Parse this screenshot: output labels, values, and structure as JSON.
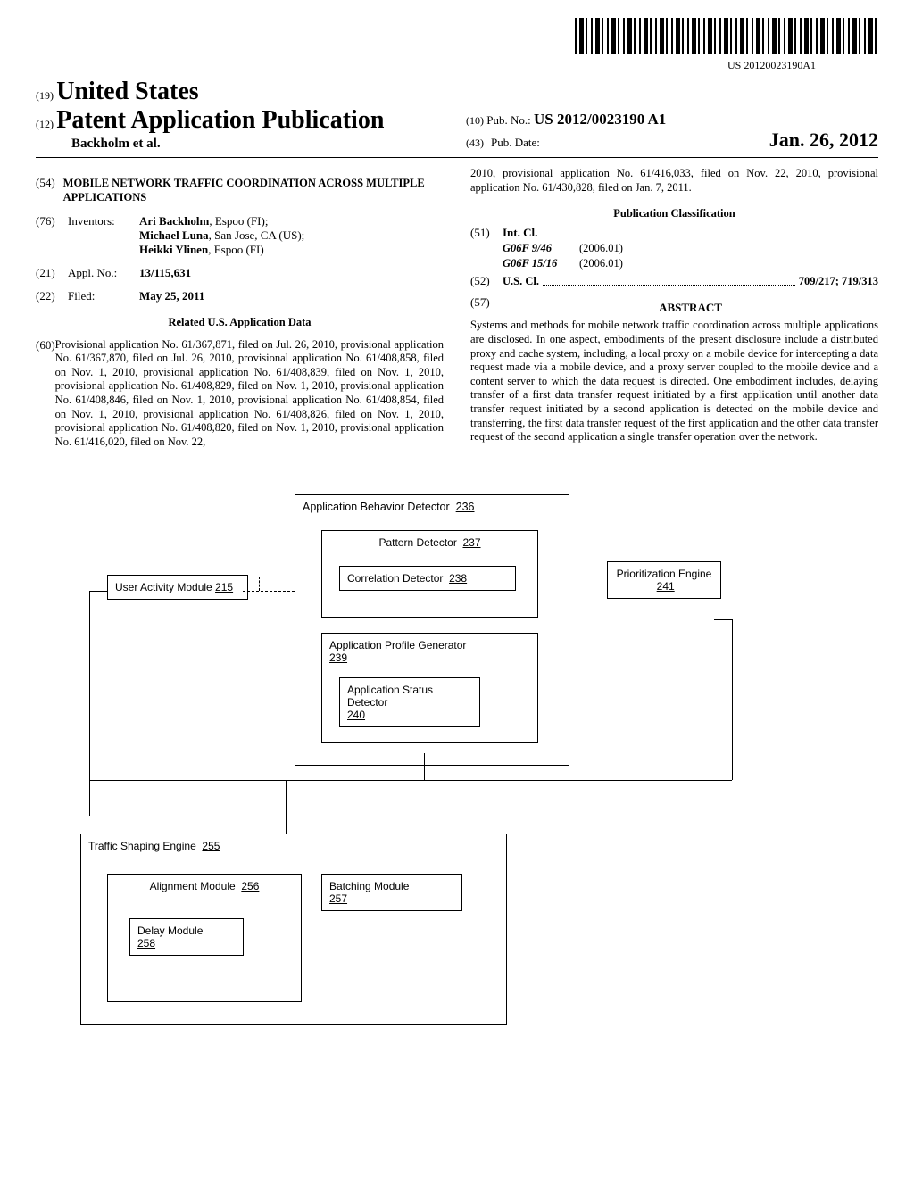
{
  "barcode_text": "US 20120023190A1",
  "header": {
    "code19": "(19)",
    "country": "United States",
    "code12": "(12)",
    "pub_type": "Patent Application Publication",
    "authors": "Backholm et al.",
    "code10": "(10)",
    "pub_no_label": "Pub. No.:",
    "pub_no": "US 2012/0023190 A1",
    "code43": "(43)",
    "pub_date_label": "Pub. Date:",
    "pub_date": "Jan. 26, 2012"
  },
  "left": {
    "code54": "(54)",
    "title": "MOBILE NETWORK TRAFFIC COORDINATION ACROSS MULTIPLE APPLICATIONS",
    "code76": "(76)",
    "inventors_label": "Inventors:",
    "inventors": [
      {
        "name": "Ari Backholm",
        "loc": ", Espoo (FI);"
      },
      {
        "name": "Michael Luna",
        "loc": ", San Jose, CA (US);"
      },
      {
        "name": "Heikki Ylinen",
        "loc": ", Espoo (FI)"
      }
    ],
    "code21": "(21)",
    "appl_label": "Appl. No.:",
    "appl_no": "13/115,631",
    "code22": "(22)",
    "filed_label": "Filed:",
    "filed_date": "May 25, 2011",
    "related_heading": "Related U.S. Application Data",
    "code60": "(60)",
    "provisional_text": "Provisional application No. 61/367,871, filed on Jul. 26, 2010, provisional application No. 61/367,870, filed on Jul. 26, 2010, provisional application No. 61/408,858, filed on Nov. 1, 2010, provisional application No. 61/408,839, filed on Nov. 1, 2010, provisional application No. 61/408,829, filed on Nov. 1, 2010, provisional application No. 61/408,846, filed on Nov. 1, 2010, provisional application No. 61/408,854, filed on Nov. 1, 2010, provisional application No. 61/408,826, filed on Nov. 1, 2010, provisional application No. 61/408,820, filed on Nov. 1, 2010, provisional application No. 61/416,020, filed on Nov. 22,"
  },
  "right": {
    "provisional_cont": "2010, provisional application No. 61/416,033, filed on Nov. 22, 2010, provisional application No. 61/430,828, filed on Jan. 7, 2011.",
    "pub_class_heading": "Publication Classification",
    "code51": "(51)",
    "intcl_label": "Int. Cl.",
    "intcl": [
      {
        "code": "G06F 9/46",
        "year": "(2006.01)"
      },
      {
        "code": "G06F 15/16",
        "year": "(2006.01)"
      }
    ],
    "code52": "(52)",
    "uscl_label": "U.S. Cl.",
    "uscl_values": "709/217; 719/313",
    "code57": "(57)",
    "abstract_label": "ABSTRACT",
    "abstract_text": "Systems and methods for mobile network traffic coordination across multiple applications are disclosed. In one aspect, embodiments of the present disclosure include a distributed proxy and cache system, including, a local proxy on a mobile device for intercepting a data request made via a mobile device, and a proxy server coupled to the mobile device and a content server to which the data request is directed. One embodiment includes, delaying transfer of a first data transfer request initiated by a first application until another data transfer request initiated by a second application is detected on the mobile device and transferring, the first data transfer request of the first application and the other data transfer request of the second application a single transfer operation over the network."
  },
  "diagram": {
    "user_activity": "User Activity Module",
    "user_activity_num": "215",
    "abd": "Application Behavior Detector",
    "abd_num": "236",
    "pattern": "Pattern Detector",
    "pattern_num": "237",
    "correlation": "Correlation Detector",
    "correlation_num": "238",
    "apg": "Application Profile Generator",
    "apg_num": "239",
    "asd": "Application Status Detector",
    "asd_num": "240",
    "prio": "Prioritization Engine",
    "prio_num": "241",
    "tse": "Traffic Shaping Engine",
    "tse_num": "255",
    "align": "Alignment Module",
    "align_num": "256",
    "batch": "Batching Module",
    "batch_num": "257",
    "delay": "Delay Module",
    "delay_num": "258"
  }
}
